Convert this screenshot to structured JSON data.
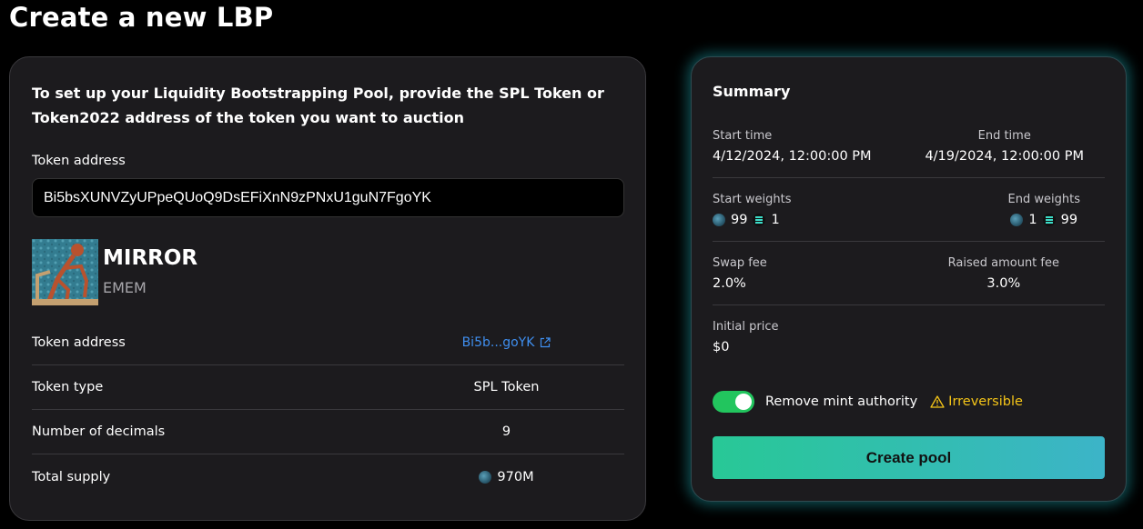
{
  "page": {
    "title": "Create a new LBP"
  },
  "setup": {
    "intro": "To set up your Liquidity Bootstrapping Pool, provide the SPL Token or Token2022 address of the token you want to auction",
    "field_label": "Token address",
    "address_value": "Bi5bsXUNVZyUPpeQUoQ9DsEFiXnN9zPNxU1guN7FgoYK"
  },
  "token": {
    "name": "MIRROR",
    "symbol": "EMEM",
    "rows": [
      {
        "label": "Token address",
        "value": "Bi5b...goYK"
      },
      {
        "label": "Token type",
        "value": "SPL Token"
      },
      {
        "label": "Number of decimals",
        "value": "9"
      },
      {
        "label": "Total supply",
        "value": "970M"
      }
    ]
  },
  "summary": {
    "title": "Summary",
    "start_time_label": "Start time",
    "start_time": "4/12/2024, 12:00:00 PM",
    "end_time_label": "End time",
    "end_time": "4/19/2024, 12:00:00 PM",
    "start_weights_label": "Start weights",
    "start_weight_token": "99",
    "start_weight_sol": "1",
    "end_weights_label": "End weights",
    "end_weight_token": "1",
    "end_weight_sol": "99",
    "swap_fee_label": "Swap fee",
    "swap_fee": "2.0%",
    "raised_fee_label": "Raised amount fee",
    "raised_fee": "3.0%",
    "initial_price_label": "Initial price",
    "initial_price": "$0",
    "toggle_label": "Remove mint authority",
    "toggle_on": true,
    "warning": "Irreversible",
    "create_button": "Create pool"
  },
  "colors": {
    "accent_green": "#22c55e",
    "link_blue": "#3f8ff0",
    "warning_yellow": "#f5c518",
    "button_gradient_start": "#28c896",
    "button_gradient_end": "#3cb4c8"
  },
  "icons": {
    "external_link": "external-link-icon",
    "warning": "warning-triangle-icon",
    "token_coin": "token-coin-icon",
    "sol_coin": "sol-coin-icon"
  }
}
